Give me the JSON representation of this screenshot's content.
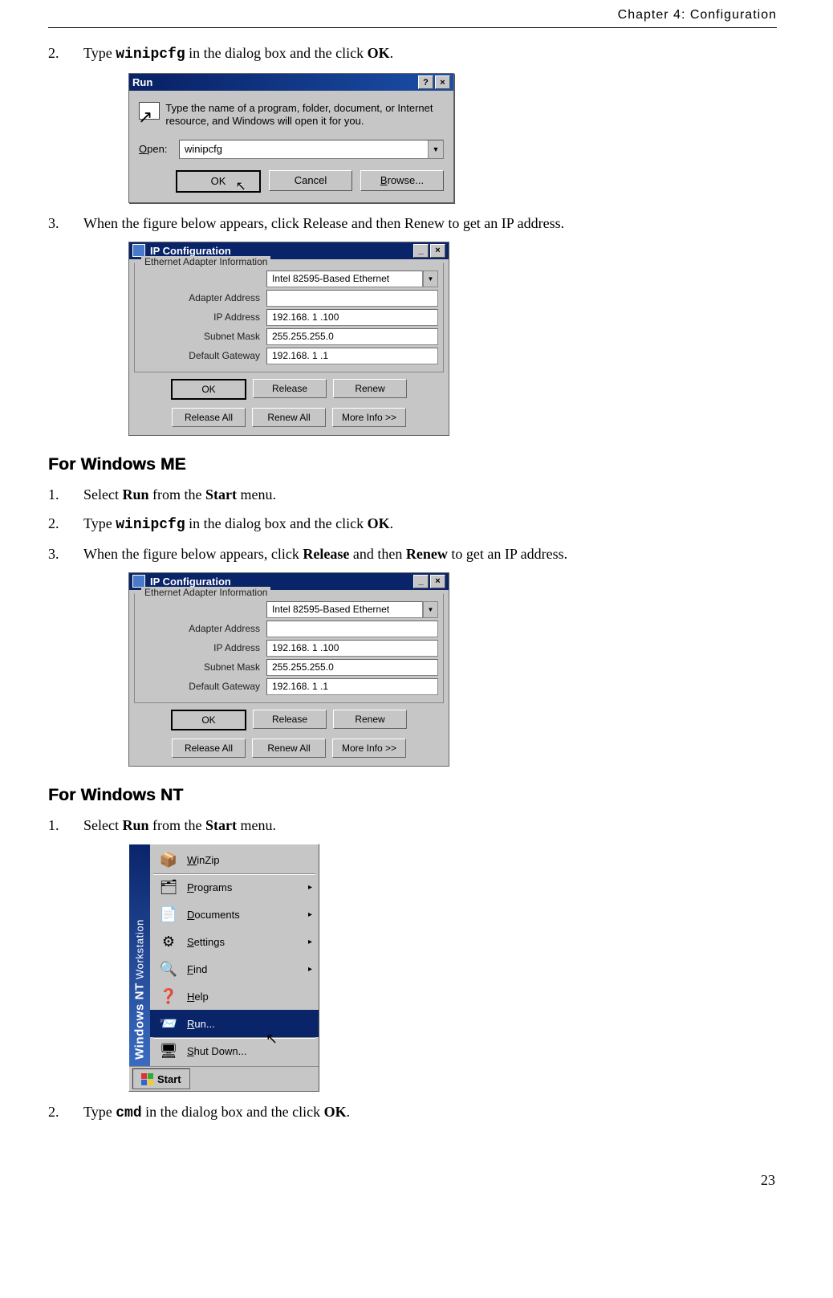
{
  "header": {
    "chapter": "Chapter 4: Configuration"
  },
  "steps_top": {
    "s2": {
      "num": "2.",
      "t1": "Type ",
      "cmd": "winipcfg",
      "t2": " in the dialog box and the click ",
      "b1": "OK",
      "t3": "."
    },
    "s3": {
      "num": "3.",
      "text": "When the figure below appears, click Release and then Renew to get an IP address."
    }
  },
  "run": {
    "title": "Run",
    "help": "?",
    "close": "×",
    "desc": "Type the name of a program, folder, document, or Internet resource, and Windows will open it for you.",
    "open_label": "Open:",
    "value": "winipcfg",
    "ok": "OK",
    "cancel": "Cancel",
    "browse": "Browse..."
  },
  "ipcfg": {
    "title": "IP Configuration",
    "group": "Ethernet Adapter Information",
    "adapter": "Intel 82595-Based Ethernet",
    "rows": {
      "addr_lbl": "Adapter Address",
      "addr_val": "",
      "ip_lbl": "IP Address",
      "ip_val": "192.168. 1 .100",
      "mask_lbl": "Subnet Mask",
      "mask_val": "255.255.255.0",
      "gw_lbl": "Default Gateway",
      "gw_val": "192.168. 1 .1"
    },
    "btns": {
      "ok": "OK",
      "release": "Release",
      "renew": "Renew",
      "release_all": "Release All",
      "renew_all": "Renew All",
      "more": "More Info >>"
    }
  },
  "me_heading": "For Windows ME",
  "me_steps": {
    "s1": {
      "num": "1.",
      "t1": "Select ",
      "b1": "Run",
      "t2": " from the ",
      "b2": "Start",
      "t3": " menu."
    },
    "s2": {
      "num": "2.",
      "t1": "Type ",
      "cmd": "winipcfg",
      "t2": " in the dialog box and the click ",
      "b1": "OK",
      "t3": "."
    },
    "s3": {
      "num": "3.",
      "t1": "When the figure below appears, click ",
      "b1": "Release",
      "t2": " and then ",
      "b2": "Renew",
      "t3": " to get an IP address."
    }
  },
  "nt_heading": "For Windows NT",
  "nt_steps": {
    "s1": {
      "num": "1.",
      "t1": "Select ",
      "b1": "Run",
      "t2": " from the ",
      "b2": "Start",
      "t3": " menu."
    },
    "s2": {
      "num": "2.",
      "t1": "Type ",
      "cmd": "cmd",
      "t2": " in the dialog box and the click ",
      "b1": "OK",
      "t3": "."
    }
  },
  "startmenu": {
    "side1": "Windows NT",
    "side2": "Workstation",
    "items": [
      {
        "icon": "📦",
        "label": "WinZip",
        "arrow": "",
        "sel": false,
        "sep": false
      },
      {
        "icon": "🗂",
        "label": "Programs",
        "arrow": "▸",
        "sel": false,
        "sep": true
      },
      {
        "icon": "📄",
        "label": "Documents",
        "arrow": "▸",
        "sel": false,
        "sep": false
      },
      {
        "icon": "⚙",
        "label": "Settings",
        "arrow": "▸",
        "sel": false,
        "sep": false
      },
      {
        "icon": "🔍",
        "label": "Find",
        "arrow": "▸",
        "sel": false,
        "sep": false
      },
      {
        "icon": "❓",
        "label": "Help",
        "arrow": "",
        "sel": false,
        "sep": false
      },
      {
        "icon": "📨",
        "label": "Run...",
        "arrow": "",
        "sel": true,
        "sep": false
      },
      {
        "icon": "🖥",
        "label": "Shut Down...",
        "arrow": "",
        "sel": false,
        "sep": true
      }
    ],
    "start": "Start"
  },
  "page_num": "23"
}
